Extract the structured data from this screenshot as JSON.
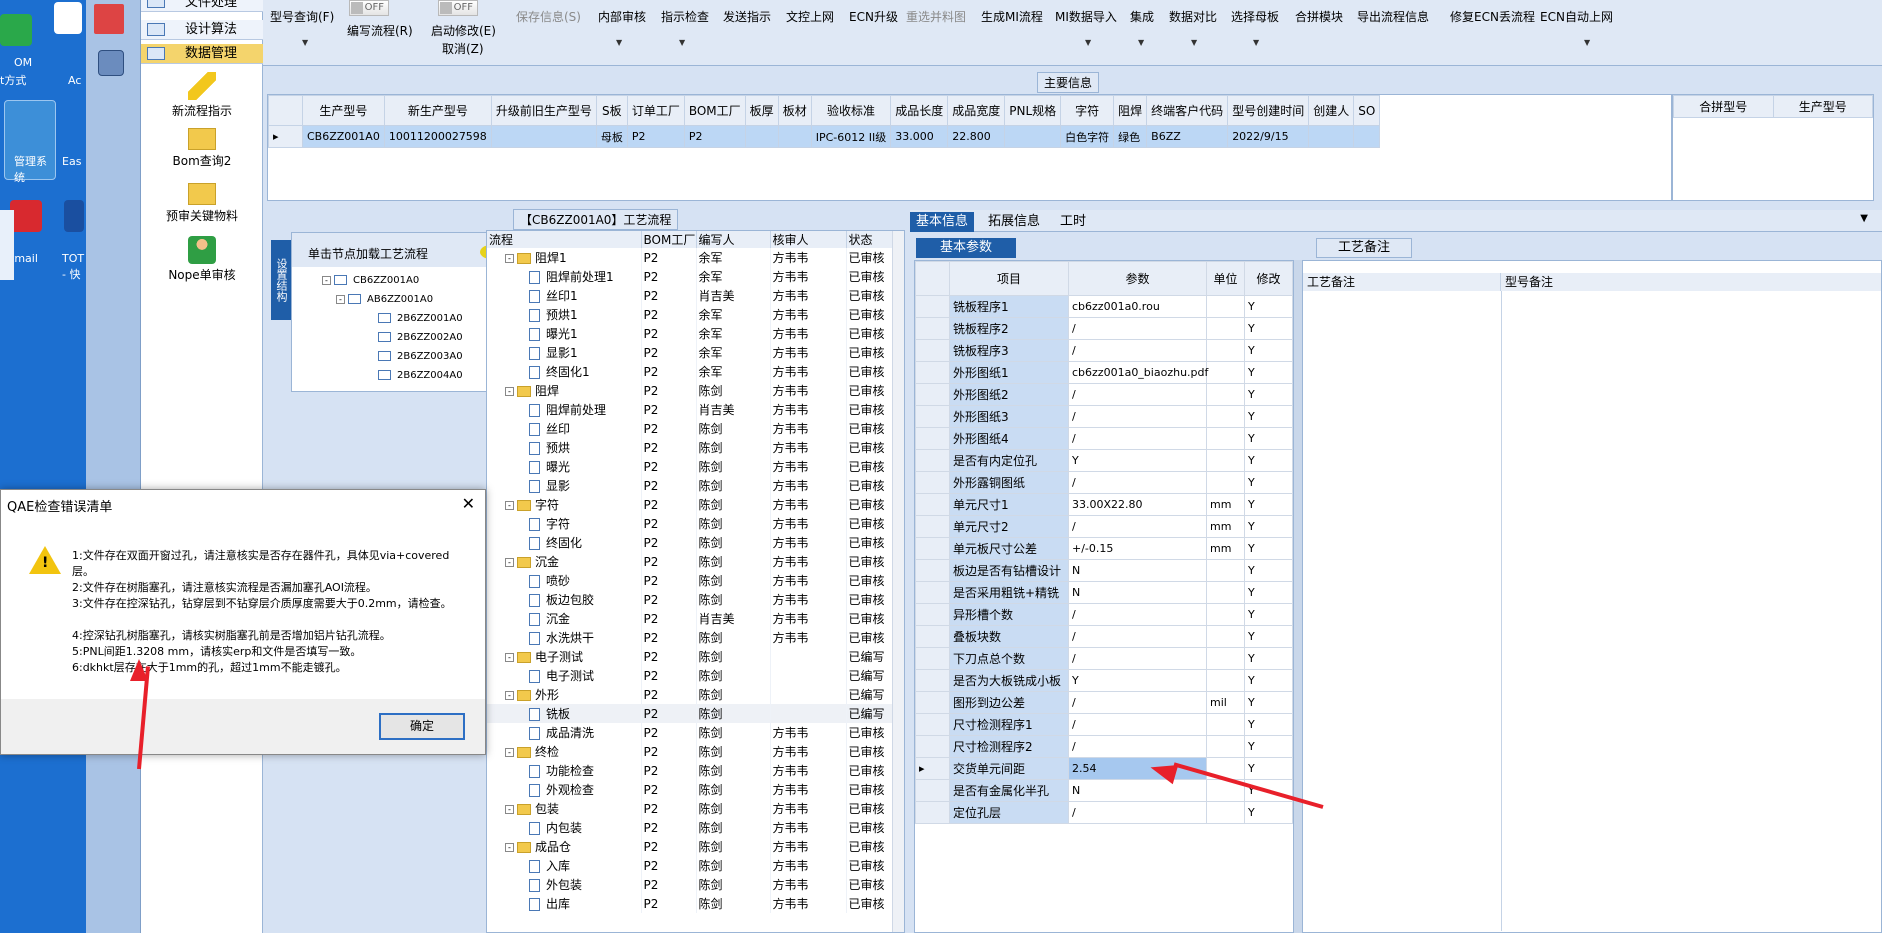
{
  "desktop": {
    "icons": [
      "OM",
      "A",
      "t方式",
      "Ac",
      "管理系",
      "Eas",
      "统",
      "tmail",
      "TOT",
      "- 快"
    ]
  },
  "nav": {
    "headers": [
      "文件处理",
      "设计算法",
      "数据管理"
    ],
    "items": [
      "新流程指示",
      "Bom查询2",
      "预审关键物料",
      "Nope单审核"
    ]
  },
  "toolbar": {
    "buttons": [
      "型号查询(F)",
      "编写流程(R)",
      "启动修改(E)",
      "取消(Z)",
      "保存信息(S)",
      "内部审核",
      "指示检查",
      "发送指示",
      "文控上网",
      "ECN升级",
      "重选并料图",
      "生成MI流程",
      "MI数据导入",
      "集成",
      "数据对比",
      "选择母板",
      "合拼模块",
      "导出流程信息",
      "修复ECN丢流程",
      "ECN自动上网"
    ],
    "toggle_text": "OFF"
  },
  "main_info": {
    "title": "主要信息",
    "columns": [
      "生产型号",
      "新生产型号",
      "升级前旧生产型号",
      "S板",
      "订单工厂",
      "BOM工厂",
      "板厚",
      "板材",
      "验收标准",
      "成品长度",
      "成品宽度",
      "PNL规格",
      "字符",
      "阻焊",
      "终端客户代码",
      "型号创建时间",
      "创建人",
      "SO"
    ],
    "row": [
      "CB6ZZ001A0",
      "10011200027598",
      "",
      "母板",
      "P2",
      "P2",
      "",
      "",
      "IPC-6012 II级",
      "33.000",
      "22.800",
      "",
      "白色字符",
      "绿色",
      "B6ZZ",
      "2022/9/15",
      "",
      ""
    ],
    "side_columns": [
      "合拼型号",
      "生产型号"
    ]
  },
  "flow": {
    "title": "【CB6ZZ001A0】工艺流程",
    "side_tab": "设置结构",
    "hint": "单击节点加载工艺流程",
    "tree": [
      "CB6ZZ001A0",
      "AB6ZZ001A0",
      "2B6ZZ001A0",
      "2B6ZZ002A0",
      "2B6ZZ003A0",
      "2B6ZZ004A0"
    ],
    "columns": [
      "流程",
      "BOM工厂",
      "编写人",
      "核审人",
      "状态"
    ],
    "rows": [
      {
        "name": "阻焊1",
        "lvl": 0,
        "f": "P2",
        "w": "余军",
        "c": "方韦韦",
        "s": "已审核"
      },
      {
        "name": "阻焊前处理1",
        "lvl": 1,
        "f": "P2",
        "w": "余军",
        "c": "方韦韦",
        "s": "已审核"
      },
      {
        "name": "丝印1",
        "lvl": 1,
        "f": "P2",
        "w": "肖吉美",
        "c": "方韦韦",
        "s": "已审核"
      },
      {
        "name": "预烘1",
        "lvl": 1,
        "f": "P2",
        "w": "余军",
        "c": "方韦韦",
        "s": "已审核"
      },
      {
        "name": "曝光1",
        "lvl": 1,
        "f": "P2",
        "w": "余军",
        "c": "方韦韦",
        "s": "已审核"
      },
      {
        "name": "显影1",
        "lvl": 1,
        "f": "P2",
        "w": "余军",
        "c": "方韦韦",
        "s": "已审核"
      },
      {
        "name": "终固化1",
        "lvl": 1,
        "f": "P2",
        "w": "余军",
        "c": "方韦韦",
        "s": "已审核"
      },
      {
        "name": "阻焊",
        "lvl": 0,
        "f": "P2",
        "w": "陈剑",
        "c": "方韦韦",
        "s": "已审核"
      },
      {
        "name": "阻焊前处理",
        "lvl": 1,
        "f": "P2",
        "w": "肖吉美",
        "c": "方韦韦",
        "s": "已审核"
      },
      {
        "name": "丝印",
        "lvl": 1,
        "f": "P2",
        "w": "陈剑",
        "c": "方韦韦",
        "s": "已审核"
      },
      {
        "name": "预烘",
        "lvl": 1,
        "f": "P2",
        "w": "陈剑",
        "c": "方韦韦",
        "s": "已审核"
      },
      {
        "name": "曝光",
        "lvl": 1,
        "f": "P2",
        "w": "陈剑",
        "c": "方韦韦",
        "s": "已审核"
      },
      {
        "name": "显影",
        "lvl": 1,
        "f": "P2",
        "w": "陈剑",
        "c": "方韦韦",
        "s": "已审核"
      },
      {
        "name": "字符",
        "lvl": 0,
        "f": "P2",
        "w": "陈剑",
        "c": "方韦韦",
        "s": "已审核"
      },
      {
        "name": "字符",
        "lvl": 1,
        "f": "P2",
        "w": "陈剑",
        "c": "方韦韦",
        "s": "已审核"
      },
      {
        "name": "终固化",
        "lvl": 1,
        "f": "P2",
        "w": "陈剑",
        "c": "方韦韦",
        "s": "已审核"
      },
      {
        "name": "沉金",
        "lvl": 0,
        "f": "P2",
        "w": "陈剑",
        "c": "方韦韦",
        "s": "已审核"
      },
      {
        "name": "喷砂",
        "lvl": 1,
        "f": "P2",
        "w": "陈剑",
        "c": "方韦韦",
        "s": "已审核"
      },
      {
        "name": "板边包胶",
        "lvl": 1,
        "f": "P2",
        "w": "陈剑",
        "c": "方韦韦",
        "s": "已审核"
      },
      {
        "name": "沉金",
        "lvl": 1,
        "f": "P2",
        "w": "肖吉美",
        "c": "方韦韦",
        "s": "已审核"
      },
      {
        "name": "水洗烘干",
        "lvl": 1,
        "f": "P2",
        "w": "陈剑",
        "c": "方韦韦",
        "s": "已审核"
      },
      {
        "name": "电子测试",
        "lvl": 0,
        "f": "P2",
        "w": "陈剑",
        "c": "",
        "s": "已编写"
      },
      {
        "name": "电子测试",
        "lvl": 1,
        "f": "P2",
        "w": "陈剑",
        "c": "",
        "s": "已编写"
      },
      {
        "name": "外形",
        "lvl": 0,
        "f": "P2",
        "w": "陈剑",
        "c": "",
        "s": "已编写"
      },
      {
        "name": "铣板",
        "lvl": 1,
        "f": "P2",
        "w": "陈剑",
        "c": "",
        "s": "已编写"
      },
      {
        "name": "成品清洗",
        "lvl": 1,
        "f": "P2",
        "w": "陈剑",
        "c": "方韦韦",
        "s": "已审核"
      },
      {
        "name": "终检",
        "lvl": 0,
        "f": "P2",
        "w": "陈剑",
        "c": "方韦韦",
        "s": "已审核"
      },
      {
        "name": "功能检查",
        "lvl": 1,
        "f": "P2",
        "w": "陈剑",
        "c": "方韦韦",
        "s": "已审核"
      },
      {
        "name": "外观检查",
        "lvl": 1,
        "f": "P2",
        "w": "陈剑",
        "c": "方韦韦",
        "s": "已审核"
      },
      {
        "name": "包装",
        "lvl": 0,
        "f": "P2",
        "w": "陈剑",
        "c": "方韦韦",
        "s": "已审核"
      },
      {
        "name": "内包装",
        "lvl": 1,
        "f": "P2",
        "w": "陈剑",
        "c": "方韦韦",
        "s": "已审核"
      },
      {
        "name": "成品仓",
        "lvl": 0,
        "f": "P2",
        "w": "陈剑",
        "c": "方韦韦",
        "s": "已审核"
      },
      {
        "name": "入库",
        "lvl": 1,
        "f": "P2",
        "w": "陈剑",
        "c": "方韦韦",
        "s": "已审核"
      },
      {
        "name": "外包装",
        "lvl": 1,
        "f": "P2",
        "w": "陈剑",
        "c": "方韦韦",
        "s": "已审核"
      },
      {
        "name": "出库",
        "lvl": 1,
        "f": "P2",
        "w": "陈剑",
        "c": "方韦韦",
        "s": "已审核"
      }
    ]
  },
  "params": {
    "tabs": [
      "基本信息",
      "拓展信息",
      "工时"
    ],
    "subtab": "基本参数",
    "columns": [
      "项目",
      "参数",
      "单位",
      "修改"
    ],
    "rows": [
      {
        "k": "铣板程序1",
        "v": "cb6zz001a0.rou",
        "u": "",
        "m": "Y"
      },
      {
        "k": "铣板程序2",
        "v": "/",
        "u": "",
        "m": "Y"
      },
      {
        "k": "铣板程序3",
        "v": "/",
        "u": "",
        "m": "Y"
      },
      {
        "k": "外形图纸1",
        "v": "cb6zz001a0_biaozhu.pdf",
        "u": "",
        "m": "Y"
      },
      {
        "k": "外形图纸2",
        "v": "/",
        "u": "",
        "m": "Y"
      },
      {
        "k": "外形图纸3",
        "v": "/",
        "u": "",
        "m": "Y"
      },
      {
        "k": "外形图纸4",
        "v": "/",
        "u": "",
        "m": "Y"
      },
      {
        "k": "是否有内定位孔",
        "v": "Y",
        "u": "",
        "m": "Y"
      },
      {
        "k": "外形露铜图纸",
        "v": "/",
        "u": "",
        "m": "Y"
      },
      {
        "k": "单元尺寸1",
        "v": "33.00X22.80",
        "u": "mm",
        "m": "Y"
      },
      {
        "k": "单元尺寸2",
        "v": "/",
        "u": "mm",
        "m": "Y"
      },
      {
        "k": "单元板尺寸公差",
        "v": "+/-0.15",
        "u": "mm",
        "m": "Y"
      },
      {
        "k": "板边是否有钻槽设计",
        "v": "N",
        "u": "",
        "m": "Y"
      },
      {
        "k": "是否采用粗铣+精铣",
        "v": "N",
        "u": "",
        "m": "Y"
      },
      {
        "k": "异形槽个数",
        "v": "/",
        "u": "",
        "m": "Y"
      },
      {
        "k": "叠板块数",
        "v": "/",
        "u": "",
        "m": "Y"
      },
      {
        "k": "下刀点总个数",
        "v": "/",
        "u": "",
        "m": "Y"
      },
      {
        "k": "是否为大板铣成小板",
        "v": "Y",
        "u": "",
        "m": "Y"
      },
      {
        "k": "图形到边公差",
        "v": "/",
        "u": "mil",
        "m": "Y"
      },
      {
        "k": "尺寸检测程序1",
        "v": "/",
        "u": "",
        "m": "Y"
      },
      {
        "k": "尺寸检测程序2",
        "v": "/",
        "u": "",
        "m": "Y"
      },
      {
        "k": "交货单元间距",
        "v": "2.54",
        "u": "",
        "m": "Y"
      },
      {
        "k": "是否有金属化半孔",
        "v": "N",
        "u": "",
        "m": "Y"
      },
      {
        "k": "定位孔层",
        "v": "/",
        "u": "",
        "m": "Y"
      }
    ]
  },
  "notes": {
    "tab": "工艺备注",
    "col1": "工艺备注",
    "col2": "型号备注"
  },
  "dialog": {
    "title": "QAE检查错误清单",
    "lines": [
      "1:文件存在双面开窗过孔，请注意核实是否存在器件孔，具体见via+covered",
      "层。",
      "2:文件存在树脂塞孔，请注意核实流程是否漏加塞孔AOI流程。",
      "3:文件存在控深钻孔，钻穿层到不钻穿层介质厚度需要大于0.2mm，请检查。",
      "",
      "4:控深钻孔树脂塞孔，请核实树脂塞孔前是否增加铝片钻孔流程。",
      "5:PNL间距1.3208 mm，请核实erp和文件是否填写一致。",
      "6:dkhkt层存在大于1mm的孔，超过1mm不能走镀孔。"
    ],
    "ok": "确定",
    "close": "✕"
  },
  "colors": {
    "accent": "#1f5ea8",
    "selected_row": "#bcd7f5",
    "arrow": "#e8202a"
  }
}
